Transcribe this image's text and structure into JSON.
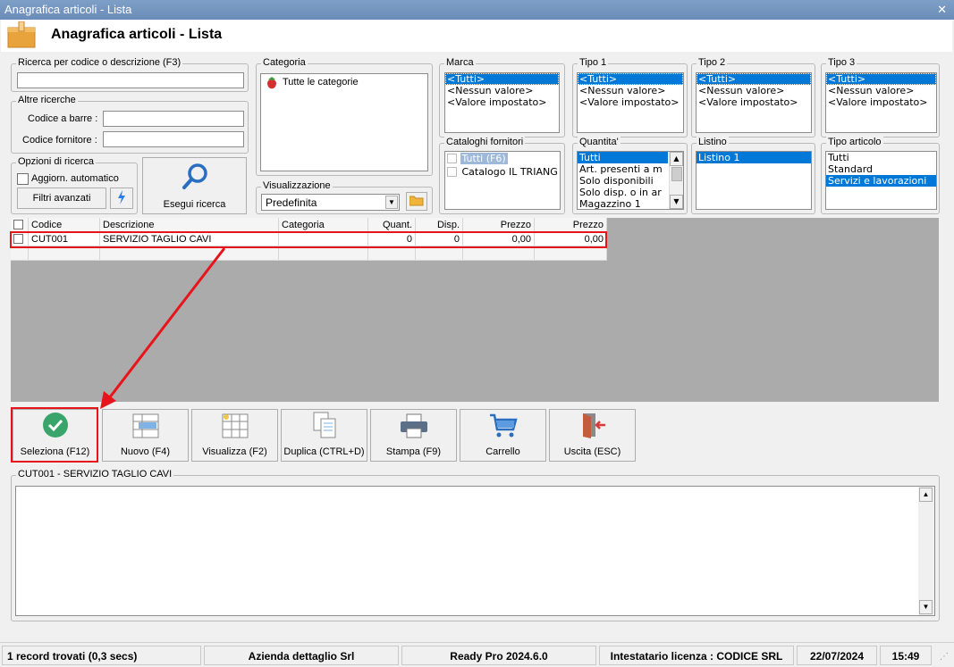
{
  "window": {
    "title": "Anagrafica articoli  - Lista",
    "close": "✕"
  },
  "header": {
    "title": "Anagrafica articoli  - Lista",
    "icon": "box-icon"
  },
  "search": {
    "label": "Ricerca per codice o descrizione (F3)",
    "value": ""
  },
  "other_searches": {
    "label": "Altre ricerche",
    "barcode_label": "Codice a barre :",
    "barcode_value": "",
    "supplier_code_label": "Codice fornitore :",
    "supplier_code_value": ""
  },
  "search_options": {
    "label": "Opzioni di ricerca",
    "auto_update_label": "Aggiorn. automatico",
    "auto_update_checked": false,
    "advanced_filters": "Filtri avanzati"
  },
  "run_search": {
    "label": "Esegui ricerca"
  },
  "category": {
    "label": "Categoria",
    "items": [
      "Tutte le categorie"
    ]
  },
  "view": {
    "label": "Visualizzazione",
    "selected": "Predefinita"
  },
  "brand": {
    "label": "Marca",
    "items": [
      "<Tutti>",
      "<Nessun valore>",
      "<Valore impostato>"
    ],
    "selected_index": 0
  },
  "type1": {
    "label": "Tipo 1",
    "items": [
      "<Tutti>",
      "<Nessun valore>",
      "<Valore impostato>"
    ],
    "selected_index": 0
  },
  "type2": {
    "label": "Tipo 2",
    "items": [
      "<Tutti>",
      "<Nessun valore>",
      "<Valore impostato>"
    ],
    "selected_index": 0
  },
  "type3": {
    "label": "Tipo 3",
    "items": [
      "<Tutti>",
      "<Nessun valore>",
      "<Valore impostato>"
    ],
    "selected_index": 0
  },
  "supplier_catalogs": {
    "label": "Cataloghi fornitori",
    "items": [
      "Tutti (F6)",
      "Catalogo IL TRIANG"
    ],
    "selected_index": 0
  },
  "quantity": {
    "label": "Quantita'",
    "items": [
      "Tutti",
      "Art. presenti a m",
      "Solo disponibili",
      "Solo disp. o in ar",
      "Magazzino 1"
    ],
    "selected_index": 0
  },
  "price_list": {
    "label": "Listino",
    "items": [
      "Listino 1"
    ],
    "selected_index": 0
  },
  "article_type": {
    "label": "Tipo articolo",
    "items": [
      "Tutti",
      "Standard",
      "Servizi e lavorazioni"
    ],
    "selected_index": 2
  },
  "grid": {
    "columns": [
      "Codice",
      "Descrizione",
      "Categoria",
      "Quant.",
      "Disp.",
      "Prezzo",
      "Prezzo"
    ],
    "rows": [
      {
        "code": "CUT001",
        "description": "SERVIZIO TAGLIO CAVI",
        "category": "",
        "qty": "0",
        "avail": "0",
        "price1": "0,00",
        "price2": "0,00"
      }
    ]
  },
  "toolbar": {
    "select": "Seleziona (F12)",
    "new": "Nuovo (F4)",
    "view": "Visualizza (F2)",
    "duplicate": "Duplica (CTRL+D)",
    "print": "Stampa (F9)",
    "cart": "Carrello",
    "exit": "Uscita (ESC)"
  },
  "detail": {
    "label": "CUT001 - SERVIZIO TAGLIO CAVI",
    "text": ""
  },
  "statusbar": {
    "records": "1 record trovati (0,3 secs)",
    "company": "Azienda dettaglio Srl",
    "version": "Ready Pro 2024.6.0",
    "license": "Intestatario licenza : CODICE SRL",
    "date": "22/07/2024",
    "time": "15:49"
  },
  "colors": {
    "accent": "#0078d7",
    "highlight_red": "#e8141b",
    "select_green": "#3aa56b",
    "titlebar": "#7396c1"
  }
}
